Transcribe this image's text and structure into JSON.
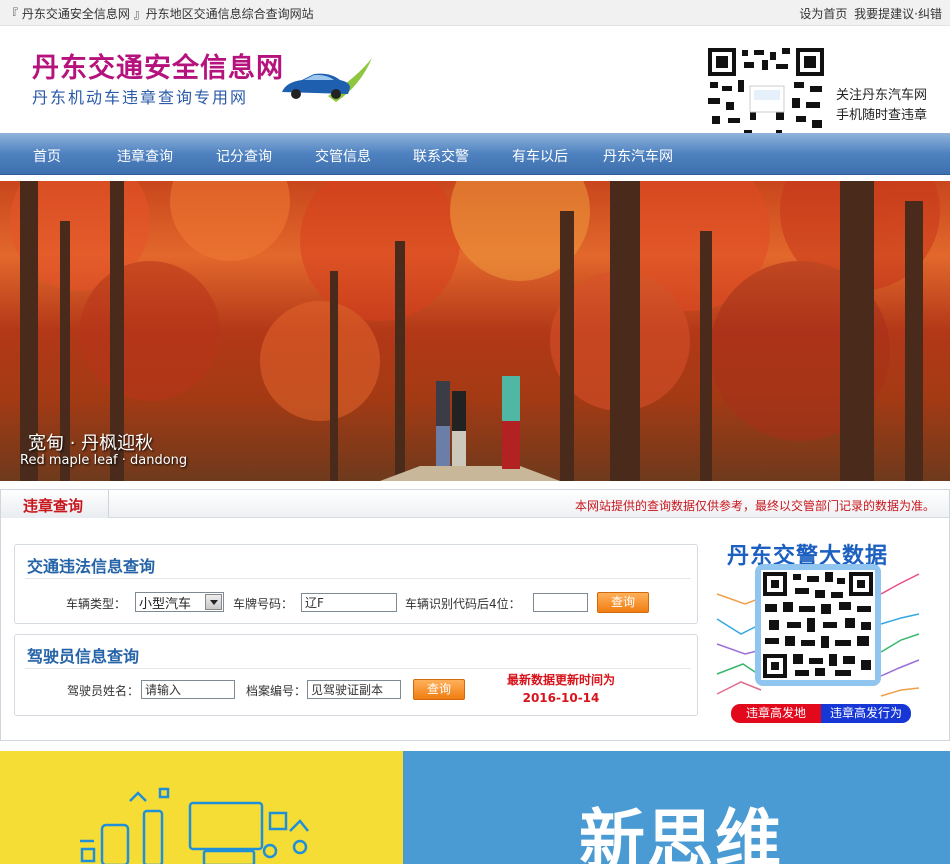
{
  "topbar": {
    "site_left": "『 丹东交通安全信息网 』丹东地区交通信息综合查询网站",
    "set_home": "设为首页",
    "suggest": "我要提建议·纠错"
  },
  "header": {
    "logo_title": "丹东交通安全信息网",
    "logo_subtitle": "丹东机动车违章查询专用网",
    "qr_caption_line1": "关注丹东汽车网",
    "qr_caption_line2": "手机随时查违章"
  },
  "nav": {
    "items": [
      {
        "label": "首页"
      },
      {
        "label": "违章查询"
      },
      {
        "label": "记分查询"
      },
      {
        "label": "交管信息"
      },
      {
        "label": "联系交警"
      },
      {
        "label": "有车以后"
      },
      {
        "label": "丹东汽车网"
      }
    ]
  },
  "banner": {
    "caption_cn": "宽甸 · 丹枫迎秋",
    "caption_en": "Red maple leaf · dandong"
  },
  "violation": {
    "section_title": "违章查询",
    "notice": "本网站提供的查询数据仅供参考，最终以交管部门记录的数据为准。",
    "traffic_box": {
      "title": "交通违法信息查询",
      "vehicle_type_label": "车辆类型：",
      "vehicle_type_value": "小型汽车",
      "plate_label": "车牌号码：",
      "plate_value": "辽F",
      "vin_label": "车辆识别代码后4位：",
      "vin_value": "",
      "query_button": "查询"
    },
    "driver_box": {
      "title": "驾驶员信息查询",
      "name_label": "驾驶员姓名：",
      "name_value": "请输入",
      "file_label": "档案编号：",
      "file_value": "见驾驶证副本",
      "query_button": "查询",
      "update_line1": "最新数据更新时间为",
      "update_date": "2016-10-14"
    },
    "bigdata": {
      "title": "丹东交警大数据",
      "pill_left": "违章高发地",
      "pill_right": "违章高发行为"
    }
  },
  "bottom": {
    "blue_text": "新思维"
  },
  "colors": {
    "nav_blue": "#4f82c0",
    "accent_red": "#c8161d",
    "title_blue": "#2563a7",
    "button_orange": "#f07d12",
    "panel_yellow": "#f6dd35",
    "panel_blue": "#4a9bd3"
  }
}
